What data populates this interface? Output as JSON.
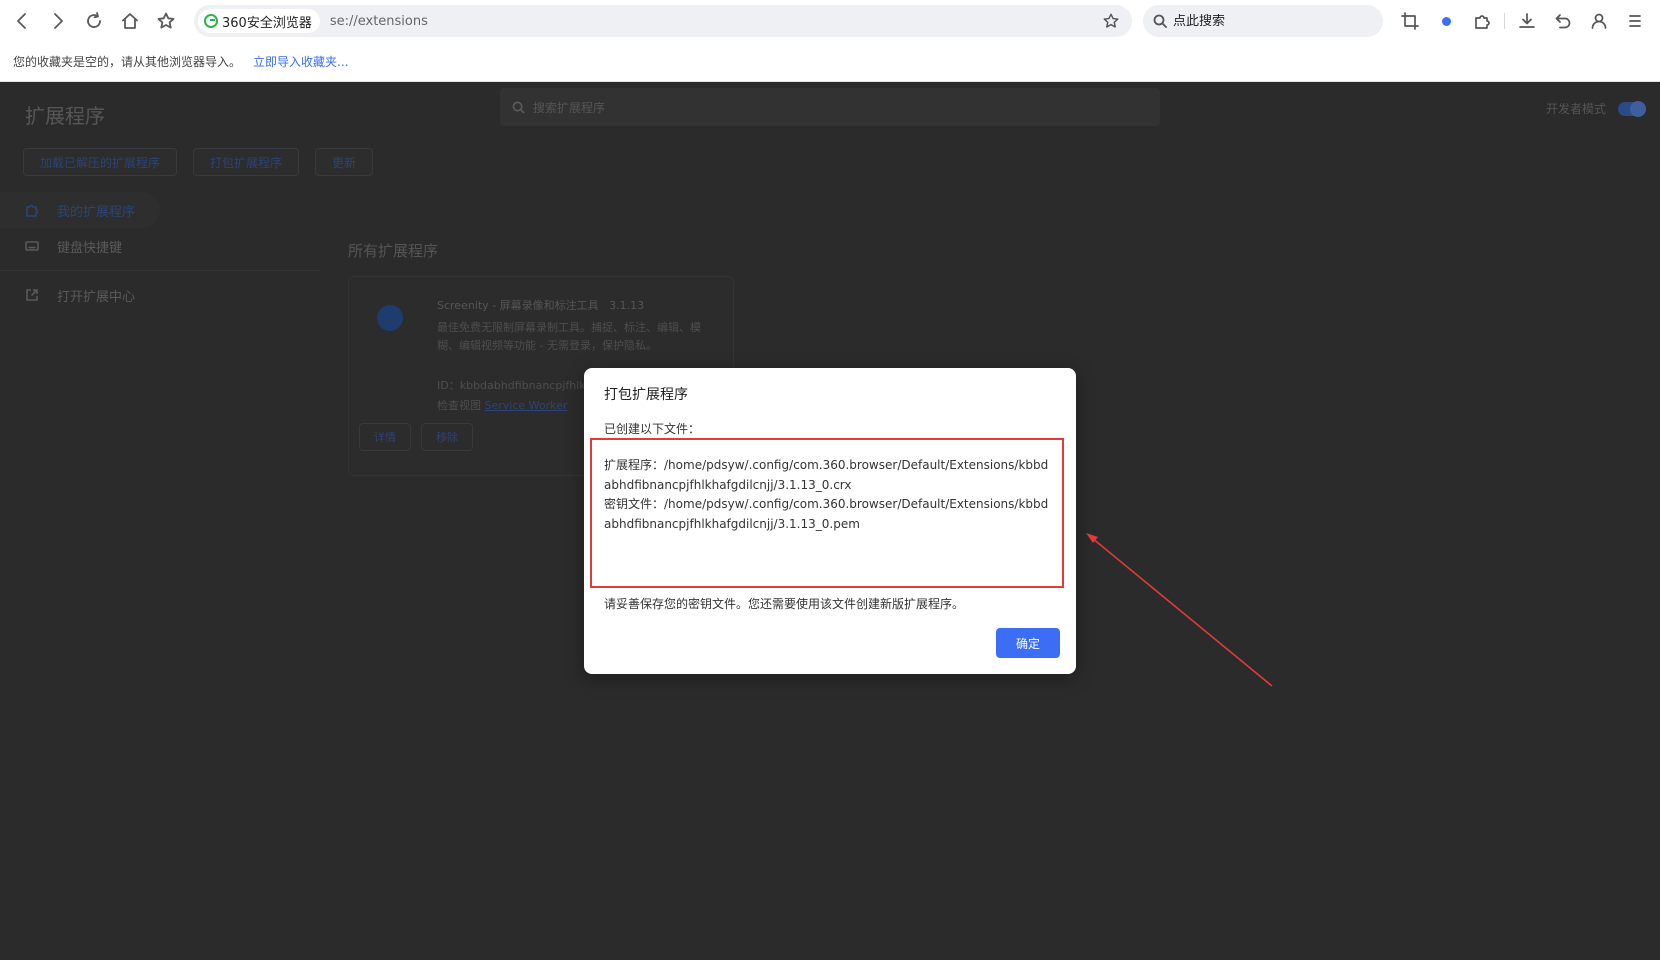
{
  "browser": {
    "site_name": "360安全浏览器",
    "url": "se://extensions",
    "search_placeholder": "点此搜索"
  },
  "bookmark_bar": {
    "empty_message": "您的收藏夹是空的，请从其他浏览器导入。",
    "import_link": "立即导入收藏夹..."
  },
  "extensions_page": {
    "title": "扩展程序",
    "search_placeholder": "搜索扩展程序",
    "developer_mode_label": "开发者模式",
    "developer_mode_on": true,
    "buttons": [
      "加载已解压的扩展程序",
      "打包扩展程序",
      "更新"
    ],
    "sidebar": [
      {
        "label": "我的扩展程序",
        "icon": "puzzle-icon",
        "active": true
      },
      {
        "label": "键盘快捷键",
        "icon": "keyboard-icon",
        "active": false
      },
      {
        "label": "打开扩展中心",
        "icon": "external-link-icon",
        "active": false
      }
    ],
    "section_label": "所有扩展程序",
    "extension": {
      "name": "Screenity - 屏幕录像和标注工具",
      "version": "3.1.13",
      "description": "最佳免费无限制屏幕录制工具。捕捉、标注、编辑、模糊、编辑视频等功能 - 无需登录，保护隐私。",
      "id": "ID：kbbdabhdfibnancpjfhlk",
      "inspect": "检查视图",
      "inspect_link": "Service Worker",
      "details_button": "详情",
      "remove_button": "移除"
    }
  },
  "dialog": {
    "title": "打包扩展程序",
    "intro": "已创建以下文件：",
    "files": [
      {
        "label": "扩展程序：",
        "path": "/home/pdsyw/.config/com.360.browser/Default/Extensions/kbbdabhdfibnancpjfhlkhafgdilcnjj/3.1.13_0.crx"
      },
      {
        "label": "密钥文件：",
        "path": "/home/pdsyw/.config/com.360.browser/Default/Extensions/kbbdabhdfibnancpjfhlkhafgdilcnjj/3.1.13_0.pem"
      }
    ],
    "note": "请妥善保存您的密钥文件。您还需要使用该文件创建新版扩展程序。",
    "ok_button": "确定"
  },
  "colors": {
    "accent": "#3b6ef5",
    "highlight_border": "#e03a3a",
    "overlay": "#2b2b2b"
  }
}
